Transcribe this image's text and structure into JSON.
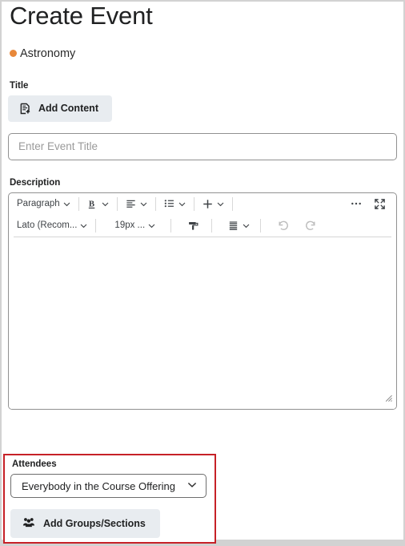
{
  "page": {
    "title": "Create Event"
  },
  "course": {
    "name": "Astronomy",
    "dot_color": "#e8883a",
    "dot_icon": "course-color-dot"
  },
  "title_field": {
    "label": "Title",
    "add_content_button": "Add Content",
    "add_content_icon": "add-content-icon",
    "input_value": "",
    "input_placeholder": "Enter Event Title"
  },
  "description": {
    "label": "Description",
    "toolbar_row1": [
      {
        "type": "select",
        "label": "Paragraph",
        "icon": "chevron-down-icon"
      },
      {
        "type": "button",
        "label": "Bold",
        "icon": "bold-icon"
      },
      {
        "type": "button",
        "label": "Align",
        "icon": "align-left-icon"
      },
      {
        "type": "button",
        "label": "Lists",
        "icon": "bullet-list-icon"
      },
      {
        "type": "button",
        "label": "Insert",
        "icon": "plus-icon"
      },
      {
        "type": "button",
        "label": "More",
        "icon": "ellipsis-icon"
      },
      {
        "type": "button",
        "label": "Fullscreen",
        "icon": "fullscreen-icon"
      }
    ],
    "toolbar_row2": [
      {
        "type": "select",
        "label": "Lato (Recom...",
        "icon": "chevron-down-icon"
      },
      {
        "type": "select",
        "label": "19px ...",
        "icon": "chevron-down-icon"
      },
      {
        "type": "button",
        "label": "Format Painter",
        "icon": "format-painter-icon"
      },
      {
        "type": "button",
        "label": "Line Height",
        "icon": "line-height-icon"
      },
      {
        "type": "button",
        "label": "Undo",
        "icon": "undo-icon"
      },
      {
        "type": "button",
        "label": "Redo",
        "icon": "redo-icon"
      }
    ],
    "font_family_value": "Lato (Recom...",
    "font_size_value": "19px ...",
    "paragraph_style_value": "Paragraph",
    "body_text": "",
    "resize_handle_icon": "resize-grip-icon"
  },
  "attendees": {
    "label": "Attendees",
    "selected_option": "Everybody in the Course Offering",
    "dropdown_icon": "chevron-down-icon",
    "add_groups_button": "Add Groups/Sections",
    "add_groups_icon": "people-group-icon",
    "highlight_color": "#c62127"
  }
}
